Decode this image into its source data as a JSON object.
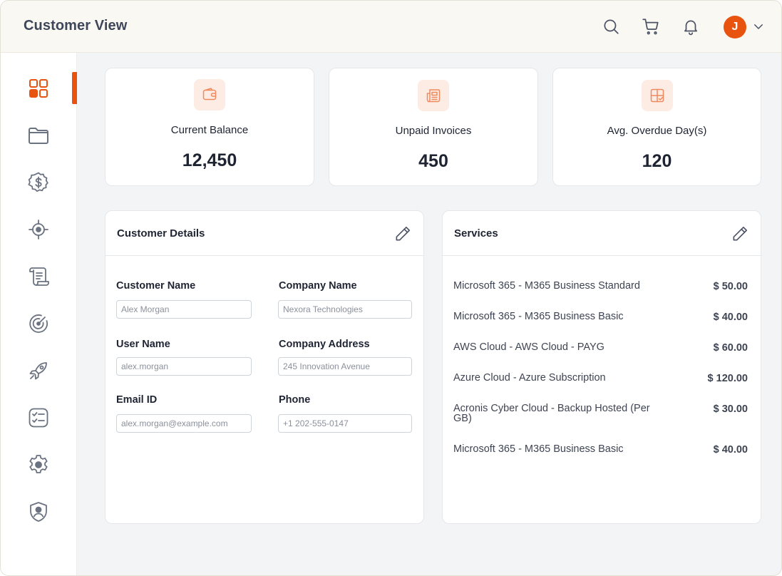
{
  "header": {
    "title": "Customer View",
    "avatar_initial": "J",
    "icons": [
      "search-icon",
      "cart-icon",
      "bell-icon",
      "chevron-down-icon"
    ]
  },
  "sidebar": {
    "items": [
      {
        "icon": "dashboard-icon",
        "active": true
      },
      {
        "icon": "folder-icon"
      },
      {
        "icon": "dollar-badge-icon"
      },
      {
        "icon": "target-icon"
      },
      {
        "icon": "scroll-icon"
      },
      {
        "icon": "radar-icon"
      },
      {
        "icon": "rocket-icon"
      },
      {
        "icon": "checklist-icon"
      },
      {
        "icon": "gear-icon"
      },
      {
        "icon": "shield-user-icon"
      }
    ]
  },
  "stats": [
    {
      "label": "Current Balance",
      "value": "12,450",
      "icon": "wallet-icon"
    },
    {
      "label": "Unpaid Invoices",
      "value": "450",
      "icon": "invoice-icon"
    },
    {
      "label": "Avg. Overdue Day(s)",
      "value": "120",
      "icon": "calendar-check-icon"
    }
  ],
  "customer_details": {
    "title": "Customer Details",
    "fields": [
      {
        "label": "Customer Name",
        "value": "Alex Morgan"
      },
      {
        "label": "Company Name",
        "value": "Nexora Technologies"
      },
      {
        "label": "User Name",
        "value": "alex.morgan"
      },
      {
        "label": "Company Address",
        "value": "245 Innovation Avenue"
      },
      {
        "label": "Email ID",
        "value": "alex.morgan@example.com"
      },
      {
        "label": "Phone",
        "value": "+1 202-555-0147"
      }
    ]
  },
  "services": {
    "title": "Services",
    "rows": [
      {
        "name": "Microsoft 365 - M365 Business Standard",
        "price": "$ 50.00"
      },
      {
        "name": "Microsoft 365 - M365 Business Basic",
        "price": "$ 40.00"
      },
      {
        "name": "AWS Cloud - AWS Cloud - PAYG",
        "price": "$ 60.00"
      },
      {
        "name": "Azure Cloud - Azure Subscription",
        "price": "$ 120.00"
      },
      {
        "name": "Acronis Cyber Cloud - Backup Hosted (Per GB)",
        "price": "$ 30.00"
      },
      {
        "name": "Microsoft 365 - M365 Business Basic",
        "price": "$ 40.00"
      }
    ]
  },
  "colors": {
    "accent": "#e8540f",
    "accent_soft": "#fdece3",
    "sidebar_icon": "#6b7280"
  }
}
